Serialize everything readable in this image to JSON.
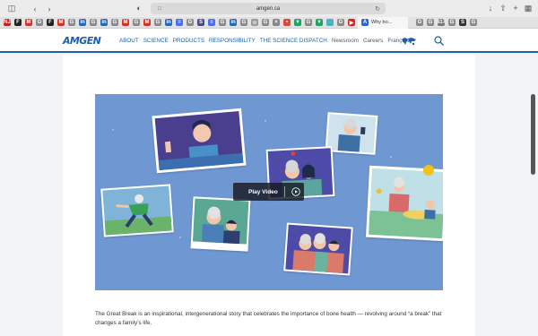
{
  "browser": {
    "url": "amgen.ca",
    "active_tab_label": "Why bo...",
    "tab_favicons": [
      {
        "label": "NJ",
        "color": "#c42020"
      },
      {
        "label": "F",
        "color": "#222222"
      },
      {
        "label": "M",
        "color": "#d93025"
      },
      {
        "label": "G",
        "color": "#8a8a8a"
      },
      {
        "label": "F",
        "color": "#222222"
      },
      {
        "label": "M",
        "color": "#d93025"
      },
      {
        "label": "G",
        "color": "#8a8a8a"
      },
      {
        "label": "in",
        "color": "#2867b2"
      },
      {
        "label": "G",
        "color": "#8a8a8a"
      },
      {
        "label": "in",
        "color": "#2867b2"
      },
      {
        "label": "G",
        "color": "#8a8a8a"
      },
      {
        "label": "M",
        "color": "#d93025"
      },
      {
        "label": "G",
        "color": "#8a8a8a"
      },
      {
        "label": "M",
        "color": "#d93025"
      },
      {
        "label": "G",
        "color": "#8a8a8a"
      },
      {
        "label": "in",
        "color": "#2867b2"
      },
      {
        "label": "≡",
        "color": "#4a6cf7"
      },
      {
        "label": "G",
        "color": "#8a8a8a"
      },
      {
        "label": "S",
        "color": "#4a4a8a"
      },
      {
        "label": "≡",
        "color": "#4a6cf7"
      },
      {
        "label": "G",
        "color": "#8a8a8a"
      },
      {
        "label": "in",
        "color": "#2867b2"
      },
      {
        "label": "G",
        "color": "#8a8a8a"
      },
      {
        "label": "☆",
        "color": "#9a9a9a"
      },
      {
        "label": "G",
        "color": "#8a8a8a"
      },
      {
        "label": "×",
        "color": "#888888"
      },
      {
        "label": "•",
        "color": "#d94a3a"
      },
      {
        "label": "▼",
        "color": "#1fa463"
      },
      {
        "label": "G",
        "color": "#8a8a8a"
      },
      {
        "label": "▼",
        "color": "#1fa463"
      },
      {
        "label": "",
        "color": "#4ab3c4"
      },
      {
        "label": "G",
        "color": "#8a8a8a"
      },
      {
        "label": "▶",
        "color": "#e02020"
      }
    ],
    "right_favicons": [
      {
        "label": "G",
        "color": "#8a8a8a"
      },
      {
        "label": "G",
        "color": "#8a8a8a"
      },
      {
        "label": "817",
        "color": "#777777"
      },
      {
        "label": "G",
        "color": "#8a8a8a"
      },
      {
        "label": "S",
        "color": "#333333"
      },
      {
        "label": "G",
        "color": "#8a8a8a"
      }
    ]
  },
  "site": {
    "logo": "AMGEN",
    "nav": {
      "about": "ABOUT",
      "science": "SCIENCE",
      "products": "PRODUCTS",
      "responsibility": "RESPONSIBILITY",
      "dispatch": "THE SCIENCE DISPATCH",
      "newsroom": "Newsroom",
      "careers": "Careers",
      "francais": "Français"
    }
  },
  "video": {
    "play_label": "Play Video",
    "background_color": "#6f98d3"
  },
  "caption": "The Great Break is an inspirational, intergenerational story that celebrates the importance of bone health — revolving around “a break” that changes a family’s life.",
  "colors": {
    "brand": "#1f5fa8"
  }
}
